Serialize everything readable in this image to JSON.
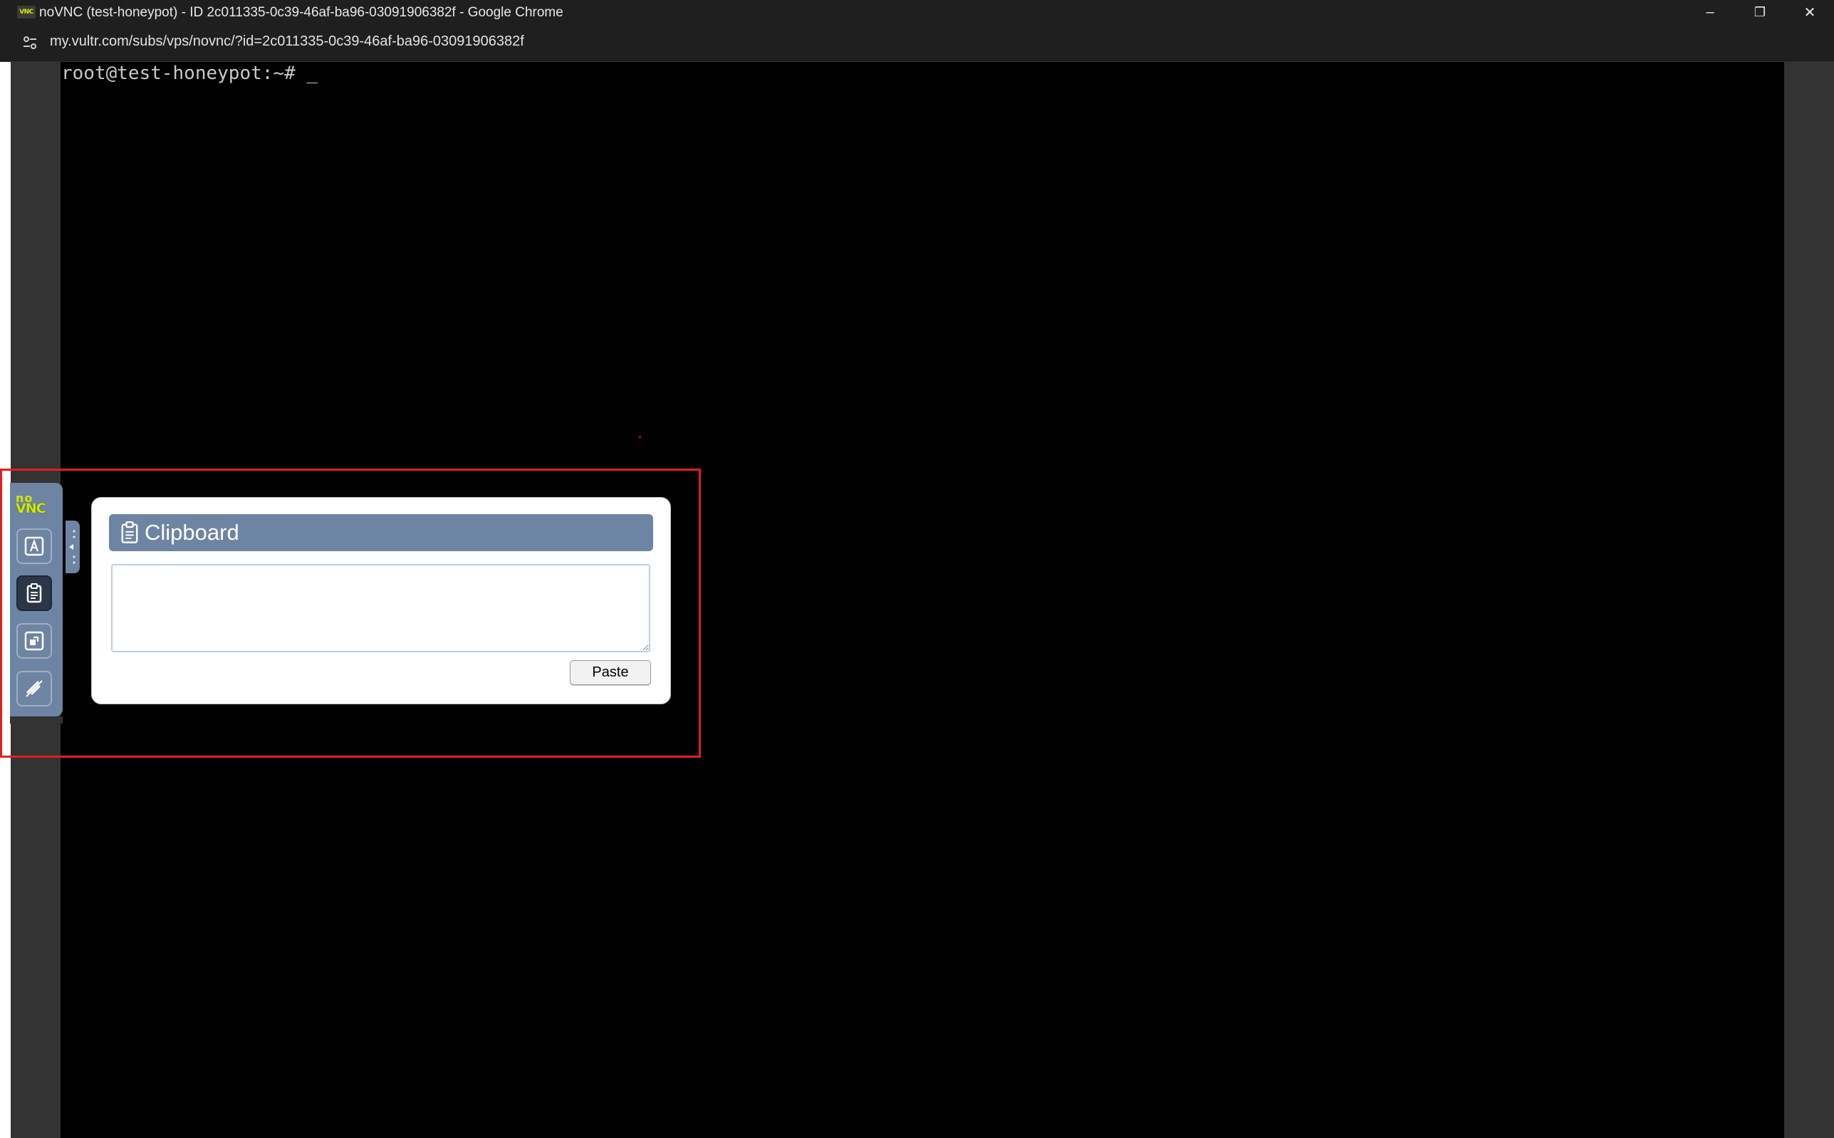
{
  "browser": {
    "app_logo": "VNC",
    "title": "noVNC (test-honeypot) - ID 2c011335-0c39-46af-ba96-03091906382f - Google Chrome",
    "url": "my.vultr.com/subs/vps/novnc/?id=2c011335-0c39-46af-ba96-03091906382f",
    "window_controls": {
      "minimize": "–",
      "restore": "❐",
      "close": "✕"
    }
  },
  "terminal": {
    "prompt": "root@test-honeypot:~# _"
  },
  "novnc": {
    "logo_top": "no",
    "logo_bottom": "VNC",
    "control_buttons": [
      {
        "name": "extra-keys",
        "icon": "keyboard-a-icon"
      },
      {
        "name": "clipboard",
        "icon": "clipboard-icon",
        "active": true
      },
      {
        "name": "fullscreen",
        "icon": "fullscreen-icon"
      },
      {
        "name": "disconnect",
        "icon": "disconnect-icon"
      }
    ],
    "clipboard_panel": {
      "title": "Clipboard",
      "text_value": "",
      "paste_label": "Paste"
    }
  },
  "colors": {
    "chrome_dark": "#1f1f1f",
    "novnc_blue": "#6e84a3",
    "novnc_logo": "#d2e800",
    "highlight_red": "#e02020"
  }
}
